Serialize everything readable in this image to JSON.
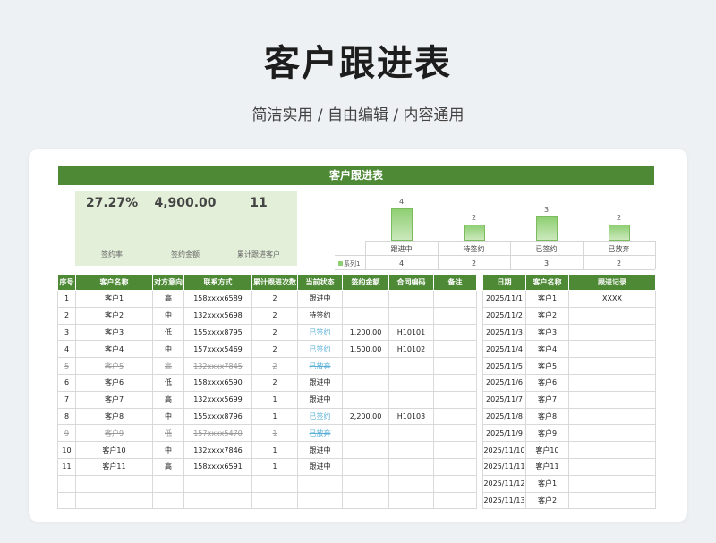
{
  "page": {
    "title": "客户跟进表",
    "subtitle": "简洁实用 / 自由编辑 / 内容通用"
  },
  "sheet": {
    "header": "客户跟进表"
  },
  "stats": [
    {
      "value": "27.27%",
      "label": "签约率"
    },
    {
      "value": "4,900.00",
      "label": "签约金额"
    },
    {
      "value": "11",
      "label": "累计跟进客户"
    }
  ],
  "chart_data": {
    "type": "bar",
    "categories": [
      "跟进中",
      "待签约",
      "已签约",
      "已放弃"
    ],
    "series": [
      {
        "name": "系列1",
        "values": [
          4,
          2,
          3,
          2
        ]
      }
    ],
    "ylim": [
      0,
      4
    ],
    "legend": "bottom-left-table",
    "grid": false,
    "colors": {
      "bar": "#8fcf74"
    }
  },
  "main_table": {
    "headers": [
      "序号",
      "客户名称",
      "对方意向",
      "联系方式",
      "累计跟进次数",
      "当前状态",
      "签约金额",
      "合同编码",
      "备注"
    ],
    "rows": [
      {
        "cells": [
          "1",
          "客户1",
          "高",
          "158xxxx6589",
          "2",
          "跟进中",
          "",
          "",
          ""
        ],
        "strike": false,
        "blue_status": false
      },
      {
        "cells": [
          "2",
          "客户2",
          "中",
          "132xxxx5698",
          "2",
          "待签约",
          "",
          "",
          ""
        ],
        "strike": false,
        "blue_status": false
      },
      {
        "cells": [
          "3",
          "客户3",
          "低",
          "155xxxx8795",
          "2",
          "已签约",
          "1,200.00",
          "H10101",
          ""
        ],
        "strike": false,
        "blue_status": true
      },
      {
        "cells": [
          "4",
          "客户4",
          "中",
          "157xxxx5469",
          "2",
          "已签约",
          "1,500.00",
          "H10102",
          ""
        ],
        "strike": false,
        "blue_status": true
      },
      {
        "cells": [
          "5",
          "客户5",
          "高",
          "132xxxx7845",
          "2",
          "已放弃",
          "",
          "",
          ""
        ],
        "strike": true,
        "blue_status": false
      },
      {
        "cells": [
          "6",
          "客户6",
          "低",
          "158xxxx6590",
          "2",
          "跟进中",
          "",
          "",
          ""
        ],
        "strike": false,
        "blue_status": false
      },
      {
        "cells": [
          "7",
          "客户7",
          "高",
          "132xxxx5699",
          "1",
          "跟进中",
          "",
          "",
          ""
        ],
        "strike": false,
        "blue_status": false
      },
      {
        "cells": [
          "8",
          "客户8",
          "中",
          "155xxxx8796",
          "1",
          "已签约",
          "2,200.00",
          "H10103",
          ""
        ],
        "strike": false,
        "blue_status": true
      },
      {
        "cells": [
          "9",
          "客户9",
          "低",
          "157xxxx5470",
          "1",
          "已放弃",
          "",
          "",
          ""
        ],
        "strike": true,
        "blue_status": false
      },
      {
        "cells": [
          "10",
          "客户10",
          "中",
          "132xxxx7846",
          "1",
          "跟进中",
          "",
          "",
          ""
        ],
        "strike": false,
        "blue_status": false
      },
      {
        "cells": [
          "11",
          "客户11",
          "高",
          "158xxxx6591",
          "1",
          "跟进中",
          "",
          "",
          ""
        ],
        "strike": false,
        "blue_status": false
      },
      {
        "cells": [
          "",
          "",
          "",
          "",
          "",
          "",
          "",
          "",
          ""
        ],
        "strike": false,
        "blue_status": false
      },
      {
        "cells": [
          "",
          "",
          "",
          "",
          "",
          "",
          "",
          "",
          ""
        ],
        "strike": false,
        "blue_status": false
      }
    ]
  },
  "side_table": {
    "headers": [
      "日期",
      "客户名称",
      "跟进记录"
    ],
    "rows": [
      [
        "2025/11/1",
        "客户1",
        "XXXX"
      ],
      [
        "2025/11/2",
        "客户2",
        ""
      ],
      [
        "2025/11/3",
        "客户3",
        ""
      ],
      [
        "2025/11/4",
        "客户4",
        ""
      ],
      [
        "2025/11/5",
        "客户5",
        ""
      ],
      [
        "2025/11/6",
        "客户6",
        ""
      ],
      [
        "2025/11/7",
        "客户7",
        ""
      ],
      [
        "2025/11/8",
        "客户8",
        ""
      ],
      [
        "2025/11/9",
        "客户9",
        ""
      ],
      [
        "2025/11/10",
        "客户10",
        ""
      ],
      [
        "2025/11/11",
        "客户11",
        ""
      ],
      [
        "2025/11/12",
        "客户1",
        ""
      ],
      [
        "2025/11/13",
        "客户2",
        ""
      ]
    ]
  }
}
